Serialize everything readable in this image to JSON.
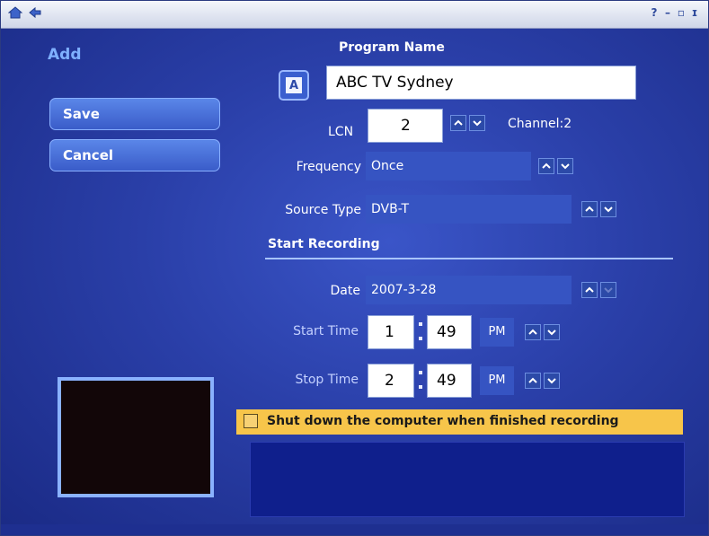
{
  "window": {
    "controls": {
      "help": "?",
      "minimize": "–",
      "restore": "▫",
      "close": "ɪ"
    }
  },
  "page": {
    "heading": "Add"
  },
  "sidebar": {
    "save_label": "Save",
    "cancel_label": "Cancel"
  },
  "form": {
    "program_name": {
      "label": "Program Name",
      "value": "ABC TV Sydney",
      "keyboard_button": "A"
    },
    "lcn": {
      "label": "LCN",
      "value": "2",
      "channel_text": "Channel:2"
    },
    "frequency": {
      "label": "Frequency",
      "value": "Once"
    },
    "source_type": {
      "label": "Source Type",
      "value": "DVB-T"
    },
    "start_recording": {
      "heading": "Start Recording"
    },
    "date": {
      "label": "Date",
      "value": "2007-3-28"
    },
    "start_time": {
      "label": "Start Time",
      "hour": "1",
      "minute": "49",
      "ampm": "PM"
    },
    "stop_time": {
      "label": "Stop Time",
      "hour": "2",
      "minute": "49",
      "ampm": "PM"
    },
    "shutdown_checkbox": {
      "label": "Shut down the computer when finished recording",
      "checked": false
    }
  },
  "colors": {
    "background": "#2a3fa8",
    "button": "#4a72dc",
    "field": "#3654c2",
    "checkbar": "#f7c54a",
    "heading_accent": "#7fb0ff"
  }
}
